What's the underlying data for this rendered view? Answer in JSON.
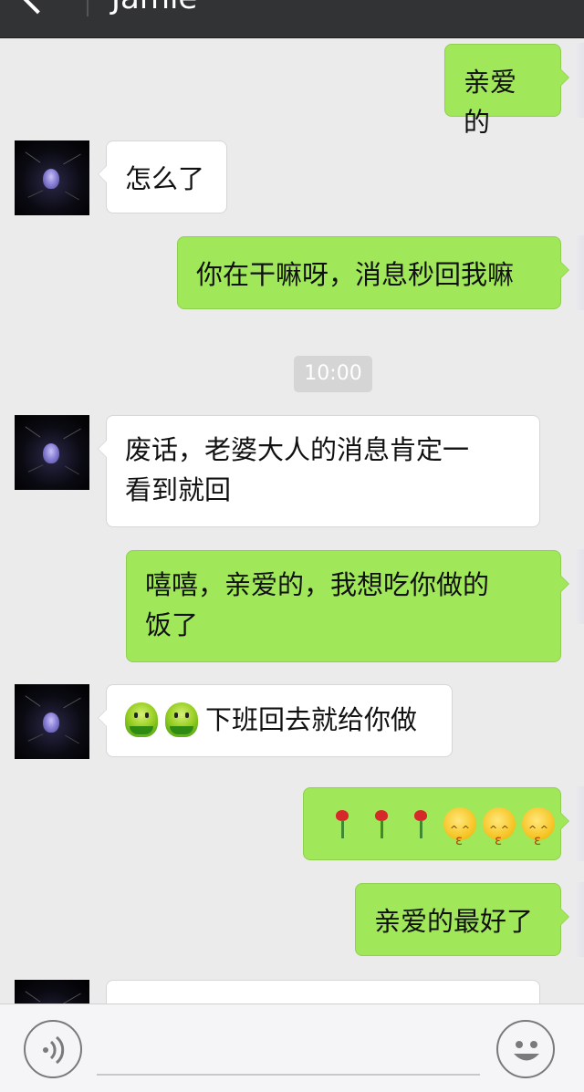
{
  "header": {
    "title": "Jamie",
    "back_icon": "chevron-left-icon"
  },
  "chat": {
    "timestamp": "10:00",
    "messages": [
      {
        "from": "me",
        "text": "亲爱的"
      },
      {
        "from": "them",
        "text": "怎么了"
      },
      {
        "from": "me",
        "text": "你在干嘛呀，消息秒回我嘛"
      },
      {
        "from": "them",
        "line1": "废话，老婆大人的消息肯定一",
        "line2": "看到就回"
      },
      {
        "from": "me",
        "line1": "嘻嘻，亲爱的，我想吃你做的",
        "line2": "饭了"
      },
      {
        "from": "them",
        "emoji": [
          "green-face-icon",
          "green-face-icon"
        ],
        "text": "下班回去就给你做"
      },
      {
        "from": "me",
        "emoji": [
          "rose-icon",
          "rose-icon",
          "rose-icon",
          "kiss-face-icon",
          "kiss-face-icon",
          "kiss-face-icon"
        ]
      },
      {
        "from": "me",
        "text": "亲爱的最好了"
      }
    ]
  },
  "input": {
    "placeholder": "",
    "voice_icon": "voice-icon",
    "emoji_icon": "emoji-icon"
  },
  "colors": {
    "outgoing_bubble": "#a0e75a",
    "incoming_bubble": "#ffffff",
    "background": "#ebebeb",
    "navbar": "#323335"
  }
}
